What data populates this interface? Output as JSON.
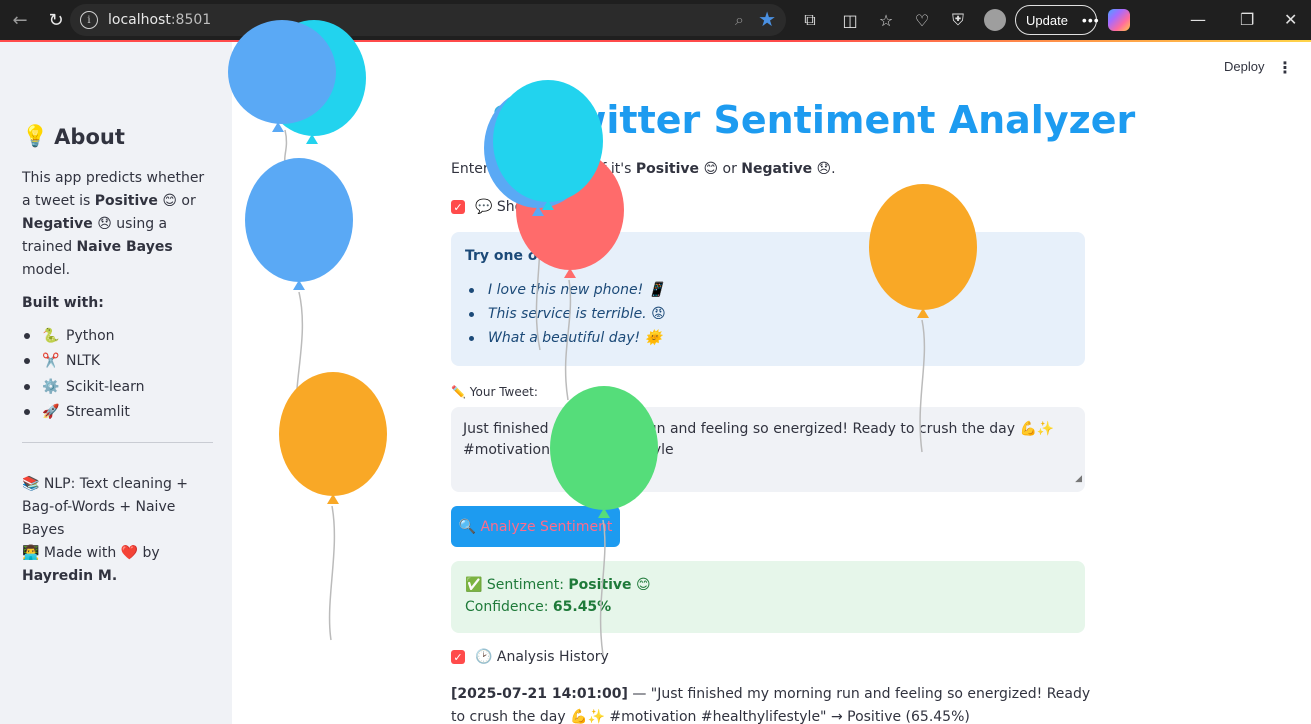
{
  "browser": {
    "url_host": "localhost",
    "url_port": ":8501",
    "update_label": "Update"
  },
  "app": {
    "deploy_label": "Deploy",
    "title_icon": "⚡",
    "title": "🐦 Twitter Sentiment Analyzer"
  },
  "sidebar": {
    "about_icon": "💡",
    "about_title": "About",
    "desc_1": "This app predicts whether a tweet is ",
    "desc_positive": "Positive",
    "desc_2": " 😊 or ",
    "desc_negative": "Negative",
    "desc_3": " 😞 using a trained ",
    "desc_model": "Naive Bayes",
    "desc_4": " model.",
    "built_with": "Built with:",
    "items": [
      {
        "icon": "🐍",
        "label": "Python"
      },
      {
        "icon": "✂️",
        "label": "NLTK"
      },
      {
        "icon": "⚙️",
        "label": "Scikit-learn"
      },
      {
        "icon": "🚀",
        "label": "Streamlit"
      }
    ],
    "footer_nlp": "📚 NLP: Text cleaning + Bag-of-Words + Naive Bayes",
    "footer_made": "👨‍💻 Made with ❤️ by",
    "footer_author": "Hayredin M."
  },
  "main": {
    "intro_1": "Enter a tweet to see if it's ",
    "intro_positive": "Positive",
    "intro_2": " 😊 or ",
    "intro_negative": "Negative",
    "intro_3": " 😞.",
    "show_examples_label": "💬 Show examples",
    "examples_heading": "Try one of these:",
    "examples": [
      "I love this new phone! 📱",
      "This service is terrible. 😡",
      "What a beautiful day! 🌞"
    ],
    "tweet_label": "✏️ Your Tweet:",
    "tweet_value": "Just finished my morning run and feeling so energized! Ready to crush the day 💪✨ #motivation #healthylifestyle",
    "analyze_button": "🔍 Analyze Sentiment",
    "result_prefix": "✅ Sentiment: ",
    "result_value": "Positive",
    "result_emoji": " 😊",
    "confidence_prefix": "Confidence: ",
    "confidence_value": "65.45%",
    "history_label": "🕑 Analysis History",
    "history_time": "[2025-07-21 14:01:00]",
    "history_text": " — \"Just finished my morning run and feeling so energized! Ready to crush the day 💪✨ #motivation #healthylifestyle\" → Positive (65.45%)"
  },
  "colors": {
    "accent": "#1d9bf0",
    "checkbox": "#ff4b4b",
    "sidebar_bg": "#f0f2f6",
    "balloon_blue": "#5aa9f5",
    "balloon_cyan": "#22d3ee",
    "balloon_orange": "#f9a826",
    "balloon_red": "#ff6b6b",
    "balloon_green": "#55dd7a"
  }
}
